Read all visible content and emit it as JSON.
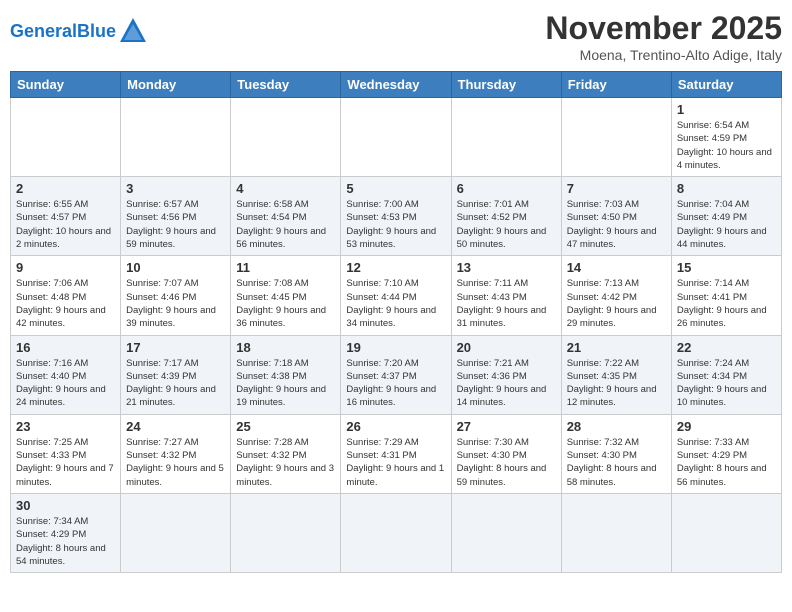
{
  "logo": {
    "text_general": "General",
    "text_blue": "Blue"
  },
  "title": "November 2025",
  "subtitle": "Moena, Trentino-Alto Adige, Italy",
  "weekdays": [
    "Sunday",
    "Monday",
    "Tuesday",
    "Wednesday",
    "Thursday",
    "Friday",
    "Saturday"
  ],
  "weeks": [
    [
      {
        "day": "",
        "info": ""
      },
      {
        "day": "",
        "info": ""
      },
      {
        "day": "",
        "info": ""
      },
      {
        "day": "",
        "info": ""
      },
      {
        "day": "",
        "info": ""
      },
      {
        "day": "",
        "info": ""
      },
      {
        "day": "1",
        "info": "Sunrise: 6:54 AM\nSunset: 4:59 PM\nDaylight: 10 hours and 4 minutes."
      }
    ],
    [
      {
        "day": "2",
        "info": "Sunrise: 6:55 AM\nSunset: 4:57 PM\nDaylight: 10 hours and 2 minutes."
      },
      {
        "day": "3",
        "info": "Sunrise: 6:57 AM\nSunset: 4:56 PM\nDaylight: 9 hours and 59 minutes."
      },
      {
        "day": "4",
        "info": "Sunrise: 6:58 AM\nSunset: 4:54 PM\nDaylight: 9 hours and 56 minutes."
      },
      {
        "day": "5",
        "info": "Sunrise: 7:00 AM\nSunset: 4:53 PM\nDaylight: 9 hours and 53 minutes."
      },
      {
        "day": "6",
        "info": "Sunrise: 7:01 AM\nSunset: 4:52 PM\nDaylight: 9 hours and 50 minutes."
      },
      {
        "day": "7",
        "info": "Sunrise: 7:03 AM\nSunset: 4:50 PM\nDaylight: 9 hours and 47 minutes."
      },
      {
        "day": "8",
        "info": "Sunrise: 7:04 AM\nSunset: 4:49 PM\nDaylight: 9 hours and 44 minutes."
      }
    ],
    [
      {
        "day": "9",
        "info": "Sunrise: 7:06 AM\nSunset: 4:48 PM\nDaylight: 9 hours and 42 minutes."
      },
      {
        "day": "10",
        "info": "Sunrise: 7:07 AM\nSunset: 4:46 PM\nDaylight: 9 hours and 39 minutes."
      },
      {
        "day": "11",
        "info": "Sunrise: 7:08 AM\nSunset: 4:45 PM\nDaylight: 9 hours and 36 minutes."
      },
      {
        "day": "12",
        "info": "Sunrise: 7:10 AM\nSunset: 4:44 PM\nDaylight: 9 hours and 34 minutes."
      },
      {
        "day": "13",
        "info": "Sunrise: 7:11 AM\nSunset: 4:43 PM\nDaylight: 9 hours and 31 minutes."
      },
      {
        "day": "14",
        "info": "Sunrise: 7:13 AM\nSunset: 4:42 PM\nDaylight: 9 hours and 29 minutes."
      },
      {
        "day": "15",
        "info": "Sunrise: 7:14 AM\nSunset: 4:41 PM\nDaylight: 9 hours and 26 minutes."
      }
    ],
    [
      {
        "day": "16",
        "info": "Sunrise: 7:16 AM\nSunset: 4:40 PM\nDaylight: 9 hours and 24 minutes."
      },
      {
        "day": "17",
        "info": "Sunrise: 7:17 AM\nSunset: 4:39 PM\nDaylight: 9 hours and 21 minutes."
      },
      {
        "day": "18",
        "info": "Sunrise: 7:18 AM\nSunset: 4:38 PM\nDaylight: 9 hours and 19 minutes."
      },
      {
        "day": "19",
        "info": "Sunrise: 7:20 AM\nSunset: 4:37 PM\nDaylight: 9 hours and 16 minutes."
      },
      {
        "day": "20",
        "info": "Sunrise: 7:21 AM\nSunset: 4:36 PM\nDaylight: 9 hours and 14 minutes."
      },
      {
        "day": "21",
        "info": "Sunrise: 7:22 AM\nSunset: 4:35 PM\nDaylight: 9 hours and 12 minutes."
      },
      {
        "day": "22",
        "info": "Sunrise: 7:24 AM\nSunset: 4:34 PM\nDaylight: 9 hours and 10 minutes."
      }
    ],
    [
      {
        "day": "23",
        "info": "Sunrise: 7:25 AM\nSunset: 4:33 PM\nDaylight: 9 hours and 7 minutes."
      },
      {
        "day": "24",
        "info": "Sunrise: 7:27 AM\nSunset: 4:32 PM\nDaylight: 9 hours and 5 minutes."
      },
      {
        "day": "25",
        "info": "Sunrise: 7:28 AM\nSunset: 4:32 PM\nDaylight: 9 hours and 3 minutes."
      },
      {
        "day": "26",
        "info": "Sunrise: 7:29 AM\nSunset: 4:31 PM\nDaylight: 9 hours and 1 minute."
      },
      {
        "day": "27",
        "info": "Sunrise: 7:30 AM\nSunset: 4:30 PM\nDaylight: 8 hours and 59 minutes."
      },
      {
        "day": "28",
        "info": "Sunrise: 7:32 AM\nSunset: 4:30 PM\nDaylight: 8 hours and 58 minutes."
      },
      {
        "day": "29",
        "info": "Sunrise: 7:33 AM\nSunset: 4:29 PM\nDaylight: 8 hours and 56 minutes."
      }
    ],
    [
      {
        "day": "30",
        "info": "Sunrise: 7:34 AM\nSunset: 4:29 PM\nDaylight: 8 hours and 54 minutes."
      },
      {
        "day": "",
        "info": ""
      },
      {
        "day": "",
        "info": ""
      },
      {
        "day": "",
        "info": ""
      },
      {
        "day": "",
        "info": ""
      },
      {
        "day": "",
        "info": ""
      },
      {
        "day": "",
        "info": ""
      }
    ]
  ]
}
